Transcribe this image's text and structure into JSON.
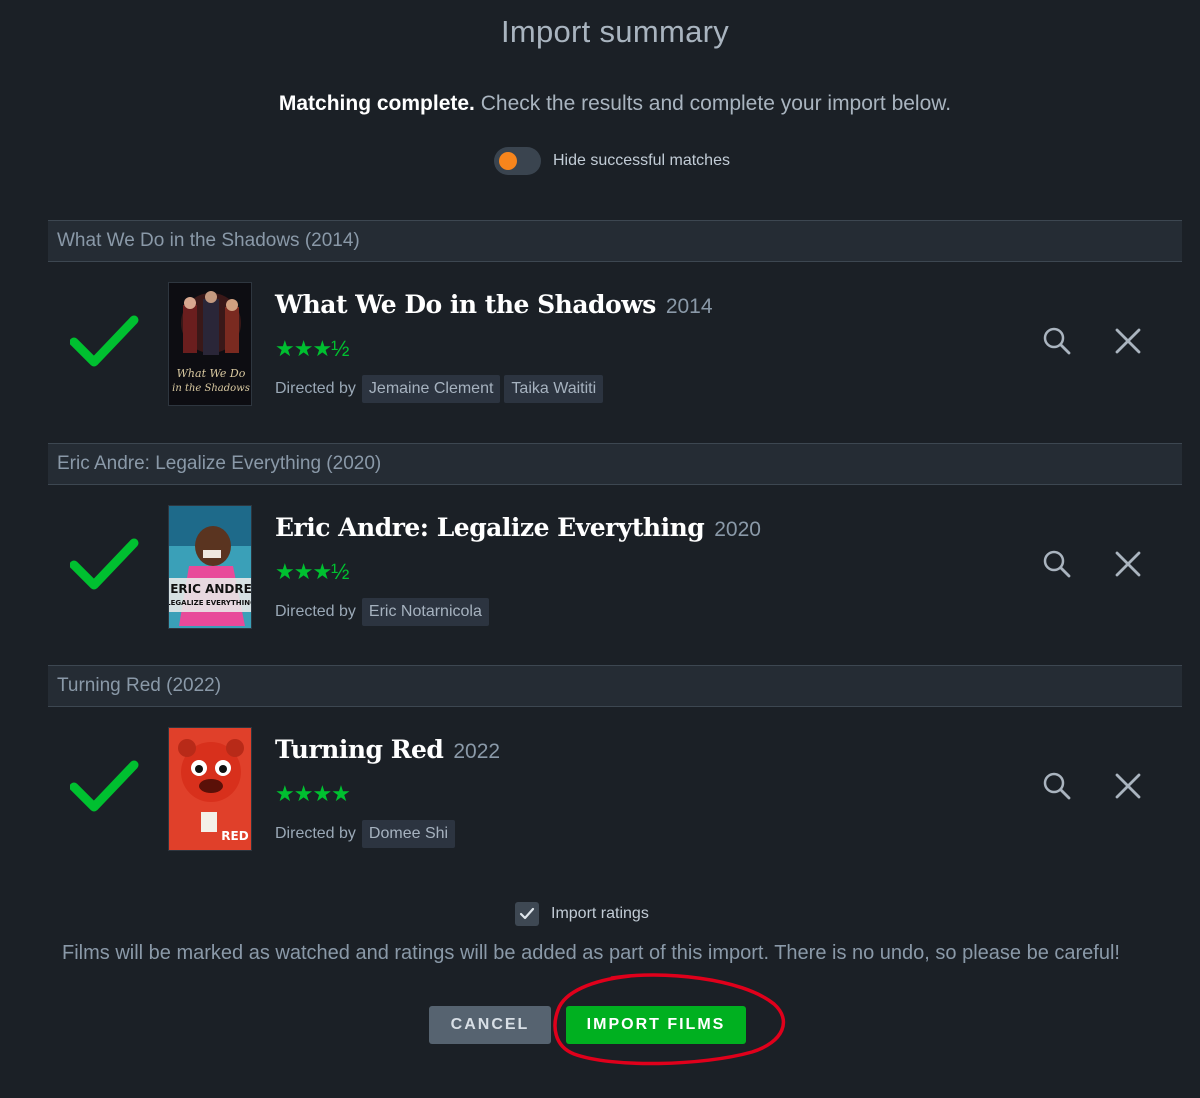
{
  "page": {
    "title": "Import summary",
    "subtitle_bold": "Matching complete.",
    "subtitle_rest": " Check the results and complete your import below.",
    "hide_matches_label": "Hide successful matches"
  },
  "films": [
    {
      "header": "What We Do in the Shadows (2014)",
      "title": "What We Do in the Shadows",
      "year": "2014",
      "rating": "★★★½",
      "directed_label": "Directed by",
      "directors": [
        "Jemaine Clement",
        "Taika Waititi"
      ],
      "poster_text": "What We Do in the Shadows"
    },
    {
      "header": "Eric Andre: Legalize Everything (2020)",
      "title": "Eric Andre: Legalize Everything",
      "year": "2020",
      "rating": "★★★½",
      "directed_label": "Directed by",
      "directors": [
        "Eric Notarnicola"
      ],
      "poster_text": "ERIC ANDRE LEGALIZE EVERYTHING"
    },
    {
      "header": "Turning Red (2022)",
      "title": "Turning Red",
      "year": "2022",
      "rating": "★★★★",
      "directed_label": "Directed by",
      "directors": [
        "Domee Shi"
      ],
      "poster_text": "RED"
    }
  ],
  "footer": {
    "import_ratings_label": "Import ratings",
    "warning": "Films will be marked as watched and ratings will be added as part of this import. There is no undo, so please be careful!",
    "cancel_label": "CANCEL",
    "import_label": "IMPORT FILMS"
  },
  "colors": {
    "background": "#1b2026",
    "accent_green": "#00b020",
    "toggle_knob": "#f7851c",
    "annotation_red": "#e0001b"
  },
  "icons": [
    "check-icon",
    "search-icon",
    "close-icon",
    "checkbox-check-icon"
  ]
}
